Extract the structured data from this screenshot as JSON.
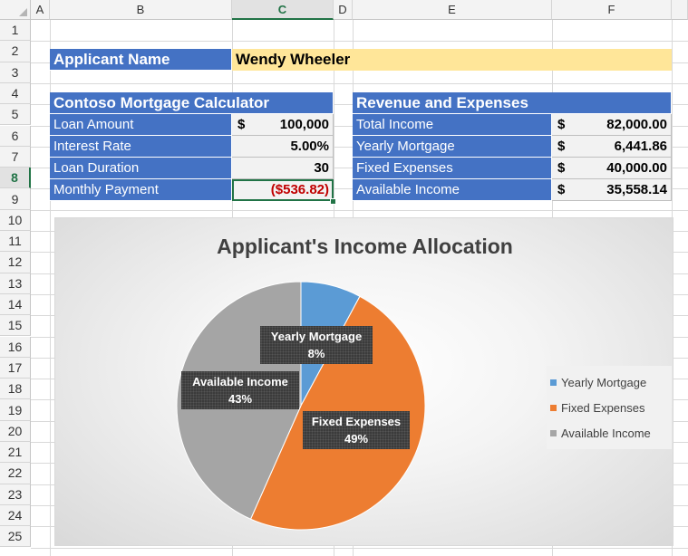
{
  "columns": [
    "A",
    "B",
    "C",
    "D",
    "E",
    "F"
  ],
  "rows": [
    "1",
    "2",
    "3",
    "4",
    "5",
    "6",
    "7",
    "8",
    "9",
    "10",
    "11",
    "12",
    "13",
    "14",
    "15",
    "16",
    "17",
    "18",
    "19",
    "20",
    "21",
    "22",
    "23",
    "24",
    "25"
  ],
  "applicant": {
    "label": "Applicant Name",
    "value": "Wendy Wheeler"
  },
  "calculator": {
    "title": "Contoso Mortgage Calculator",
    "rows": [
      {
        "label": "Loan Amount",
        "currency": "$",
        "value": "100,000"
      },
      {
        "label": "Interest Rate",
        "currency": "",
        "value": "5.00%"
      },
      {
        "label": "Loan Duration",
        "currency": "",
        "value": "30"
      },
      {
        "label": "Monthly  Payment",
        "currency": "",
        "value": "($536.82)"
      }
    ]
  },
  "revenue": {
    "title": "Revenue and Expenses",
    "rows": [
      {
        "label": "Total Income",
        "currency": "$",
        "value": "82,000.00"
      },
      {
        "label": "Yearly Mortgage",
        "currency": "$",
        "value": "6,441.86"
      },
      {
        "label": "Fixed Expenses",
        "currency": "$",
        "value": "40,000.00"
      },
      {
        "label": "Available Income",
        "currency": "$",
        "value": "35,558.14"
      }
    ]
  },
  "chart_data": {
    "type": "pie",
    "title": "Applicant's Income Allocation",
    "categories": [
      "Yearly Mortgage",
      "Fixed Expenses",
      "Available Income"
    ],
    "values": [
      6441.86,
      40000.0,
      35558.14
    ],
    "percent_labels": [
      "8%",
      "49%",
      "43%"
    ],
    "colors": [
      "#5b9bd5",
      "#ed7d31",
      "#a5a5a5"
    ],
    "legend_position": "right"
  }
}
